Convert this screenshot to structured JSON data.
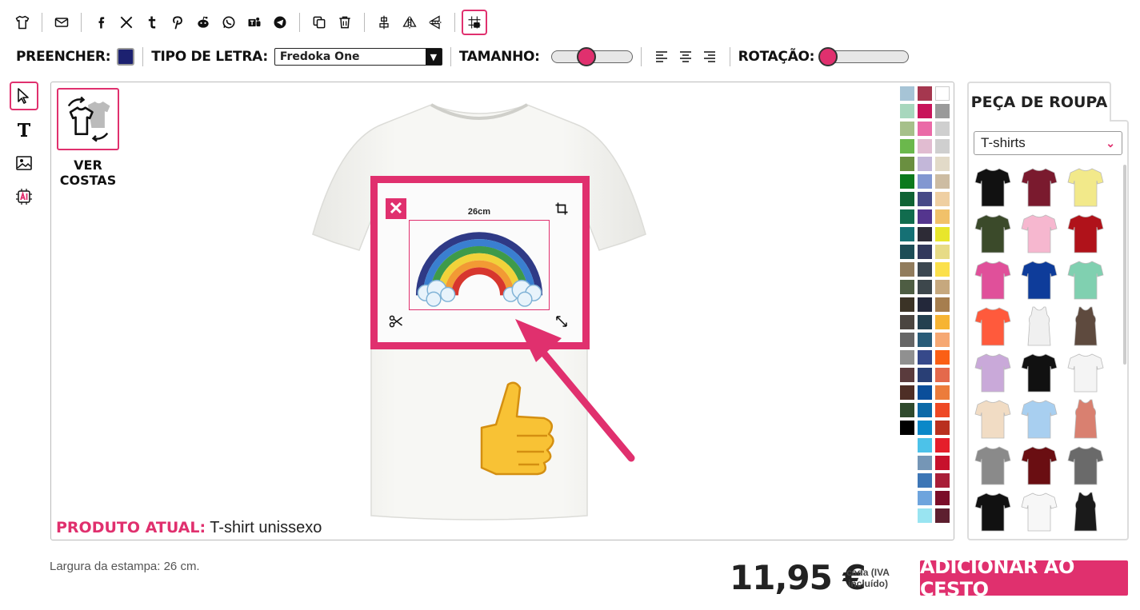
{
  "toolbar1": {
    "buttons": [
      {
        "name": "tshirt-icon",
        "glyph": "👕"
      },
      {
        "name": "email-icon"
      },
      {
        "name": "facebook-icon",
        "glyph": "f"
      },
      {
        "name": "x-twitter-icon",
        "glyph": "𝕏"
      },
      {
        "name": "tumblr-icon",
        "glyph": "t"
      },
      {
        "name": "pinterest-icon"
      },
      {
        "name": "reddit-icon"
      },
      {
        "name": "whatsapp-icon"
      },
      {
        "name": "teams-icon"
      },
      {
        "name": "telegram-icon"
      },
      {
        "name": "duplicate-icon"
      },
      {
        "name": "trash-icon"
      },
      {
        "name": "align-center-icon"
      },
      {
        "name": "flip-horizontal-icon"
      },
      {
        "name": "flip-vertical-icon"
      },
      {
        "name": "grid-lock-icon"
      }
    ]
  },
  "toolbar2": {
    "fill_label": "PREENCHER:",
    "fill_color": "#1c2170",
    "font_label": "TIPO DE LETRA:",
    "font_value": "Fredoka One",
    "size_label": "TAMANHO:",
    "size_level": 0.3,
    "rotation_label": "ROTAÇÃO:",
    "rotation_level": 0.0
  },
  "left_tools": [
    "pointer-icon",
    "text-icon",
    "image-icon",
    "ai-icon"
  ],
  "canvas": {
    "back_label": "VER COSTAS",
    "width_tag": "26cm",
    "product_label": "PRODUTO ATUAL:",
    "product_name": "T-shirt unissexo"
  },
  "palette": {
    "col1": [
      "#a6c4d6",
      "#a7d7bd",
      "#a6c08a",
      "#6bb84c",
      "#6a8f40",
      "#0c7a1d",
      "#0f6334",
      "#116c4e",
      "#157074",
      "#1c4d57",
      "#917c5d",
      "#4e5d43",
      "#3b3326",
      "#4b4540",
      "#666666",
      "#909090",
      "#5a3b3d",
      "#4e2e26",
      "#2f4a2d",
      "#000000"
    ],
    "col2": [
      "#a5374f",
      "#c8145a",
      "#ea6aa7",
      "#e1bcd1",
      "#c3b7d9",
      "#8297d1",
      "#474a87",
      "#54358e",
      "#2d2b36",
      "#31395c",
      "#3c4750",
      "#3d474c",
      "#23283a",
      "#234050",
      "#2a5c78",
      "#36498a",
      "#293f75",
      "#0a4e9a",
      "#0d6aa8",
      "#0b88c8",
      "#4cc2e9",
      "#7596b6",
      "#3d76b6",
      "#6ea4dd",
      "#99e4f1"
    ],
    "col3": [
      "#ffffff",
      "#9a9a9a",
      "#cfcfcf",
      "#cfcfcf",
      "#e2dac8",
      "#cdbca2",
      "#efcfa2",
      "#f1c16a",
      "#e8e62c",
      "#e7db86",
      "#fbe04b",
      "#c6a87e",
      "#a67e4e",
      "#f6b433",
      "#f6a873",
      "#fb5f15",
      "#e4694c",
      "#ec7c3b",
      "#ee4925",
      "#b9301f",
      "#e51e2b",
      "#c7112c",
      "#a91e38",
      "#7a0d28",
      "#5d1f2f"
    ]
  },
  "right_panel": {
    "tab_title": "PEÇA DE ROUPA",
    "category_value": "T-shirts",
    "items": [
      {
        "color": "#111111",
        "name": "tshirt-black"
      },
      {
        "color": "#7a1a2e",
        "name": "tshirt-burgundy"
      },
      {
        "color": "#f2e98a",
        "name": "tshirt-yellow"
      },
      {
        "color": "#3b4a2a",
        "name": "tshirt-olive"
      },
      {
        "color": "#f6b7cf",
        "name": "tshirt-pink"
      },
      {
        "color": "#b0121a",
        "name": "tshirt-red"
      },
      {
        "color": "#e0509a",
        "name": "tshirt-fuchsia"
      },
      {
        "color": "#0e3c9a",
        "name": "tshirt-royal"
      },
      {
        "color": "#80d0b0",
        "name": "tshirt-mint"
      },
      {
        "color": "#ff5a3c",
        "name": "tshirt-coral"
      },
      {
        "color": "#f0f0f0",
        "name": "tank-white"
      },
      {
        "color": "#5e4a3e",
        "name": "tank-brown"
      },
      {
        "color": "#c9a9d9",
        "name": "tshirt-tiedye"
      },
      {
        "color": "#111111",
        "name": "tshirt-black-v"
      },
      {
        "color": "#f4f4f4",
        "name": "raglan-white-black"
      },
      {
        "color": "#f1dcc4",
        "name": "tshirt-cream"
      },
      {
        "color": "#a8cff0",
        "name": "tshirt-sky"
      },
      {
        "color": "#d98070",
        "name": "tank-salmon"
      },
      {
        "color": "#8a8a8a",
        "name": "crop-grey"
      },
      {
        "color": "#6a0e12",
        "name": "longsleeve-maroon"
      },
      {
        "color": "#6a6a6a",
        "name": "tshirt-grey"
      },
      {
        "color": "#111111",
        "name": "tshirt-black-2"
      },
      {
        "color": "#f7f7f7",
        "name": "tshirt-white"
      },
      {
        "color": "#1a1a1a",
        "name": "dress-black"
      }
    ]
  },
  "footer": {
    "width_note": "Largura da estampa: 26 cm.",
    "price": "11,95 €",
    "price_note": "cada (IVA incluído)",
    "cart_button": "ADICIONAR AO CESTO"
  },
  "colors": {
    "accent": "#e0306e"
  }
}
